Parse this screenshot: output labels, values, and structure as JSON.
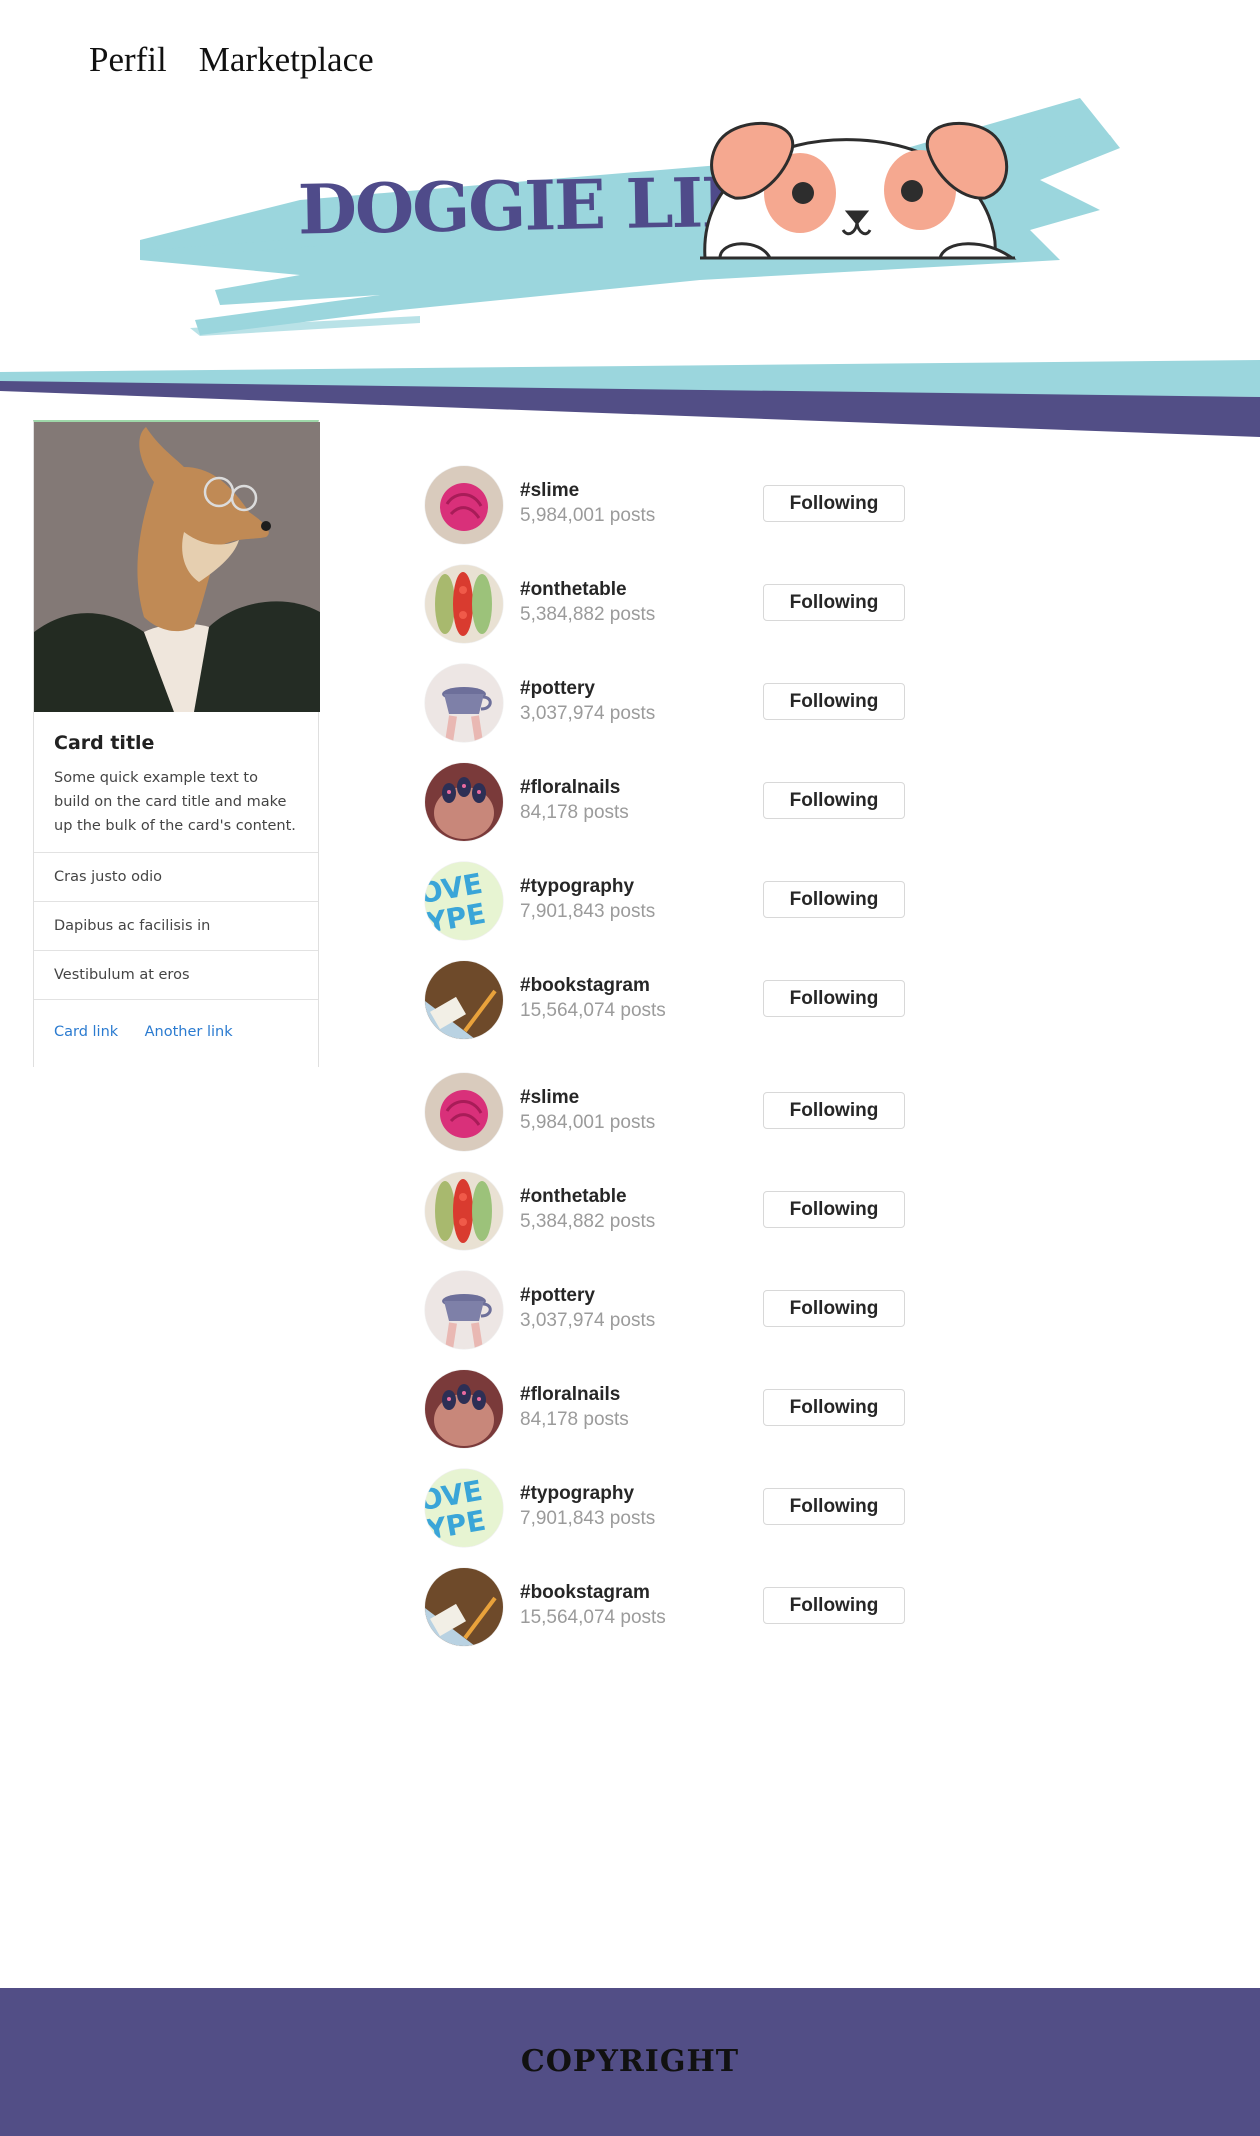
{
  "nav": {
    "items": [
      {
        "label": "Perfil"
      },
      {
        "label": "Marketplace"
      }
    ]
  },
  "banner": {
    "title": "DOGGIE LIFE",
    "colors": {
      "brush": "#9bd6dd",
      "title": "#4f4b8a",
      "ears": "#f5a890"
    }
  },
  "stripes": {
    "colors": {
      "teal": "#9bd6dd",
      "purple": "#524e86"
    }
  },
  "card": {
    "image": "dog-with-glasses-photo",
    "title": "Card title",
    "text": "Some quick example text to build on the card title and make up the bulk of the card's content.",
    "list": [
      "Cras justo odio",
      "Dapibus ac facilisis in",
      "Vestibulum at eros"
    ],
    "links": [
      "Card link",
      "Another link"
    ]
  },
  "hashtags": [
    {
      "tag": "#slime",
      "posts": "5,984,001 posts",
      "button": "Following",
      "icon": "pink-slime-avatar"
    },
    {
      "tag": "#onthetable",
      "posts": "5,384,882 posts",
      "button": "Following",
      "icon": "food-plate-avatar"
    },
    {
      "tag": "#pottery",
      "posts": "3,037,974 posts",
      "button": "Following",
      "icon": "pottery-cup-avatar"
    },
    {
      "tag": "#floralnails",
      "posts": "84,178 posts",
      "button": "Following",
      "icon": "nails-avatar"
    },
    {
      "tag": "#typography",
      "posts": "7,901,843 posts",
      "button": "Following",
      "icon": "typography-avatar"
    },
    {
      "tag": "#bookstagram",
      "posts": "15,564,074 posts",
      "button": "Following",
      "icon": "book-avatar"
    },
    {
      "tag": "#slime",
      "posts": "5,984,001 posts",
      "button": "Following",
      "icon": "pink-slime-avatar"
    },
    {
      "tag": "#onthetable",
      "posts": "5,384,882 posts",
      "button": "Following",
      "icon": "food-plate-avatar"
    },
    {
      "tag": "#pottery",
      "posts": "3,037,974 posts",
      "button": "Following",
      "icon": "pottery-cup-avatar"
    },
    {
      "tag": "#floralnails",
      "posts": "84,178 posts",
      "button": "Following",
      "icon": "nails-avatar"
    },
    {
      "tag": "#typography",
      "posts": "7,901,843 posts",
      "button": "Following",
      "icon": "typography-avatar"
    },
    {
      "tag": "#bookstagram",
      "posts": "15,564,074 posts",
      "button": "Following",
      "icon": "book-avatar"
    }
  ],
  "footer": {
    "text": "COPYRIGHT",
    "color": "#524e86"
  }
}
